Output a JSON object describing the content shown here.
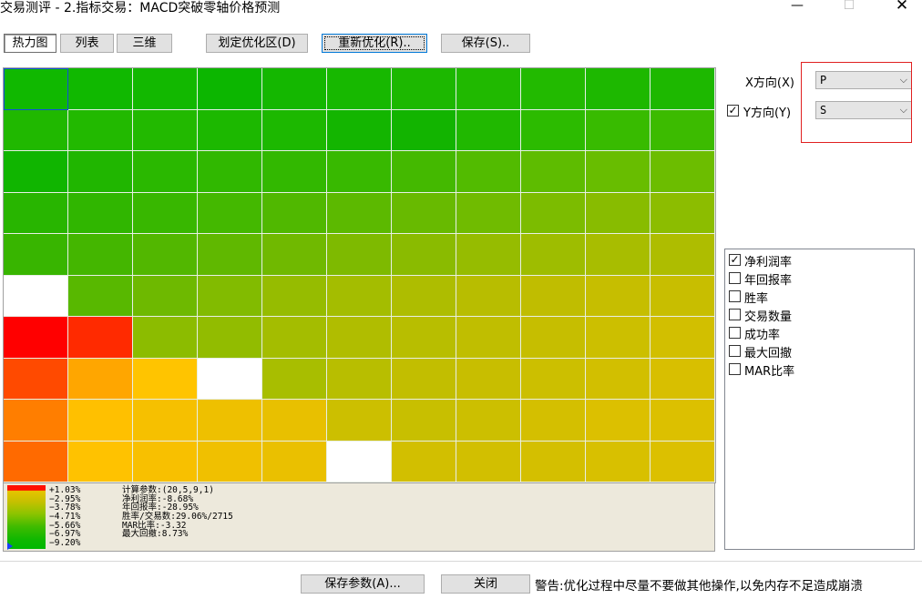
{
  "window": {
    "title": "交易测评 - 2.指标交易：MACD突破零轴价格预测",
    "min_glyph": "—",
    "max_glyph": "☐",
    "close_glyph": "✕"
  },
  "tabs": [
    {
      "label": "热力图",
      "active": true
    },
    {
      "label": "列表",
      "active": false
    },
    {
      "label": "三维",
      "active": false
    }
  ],
  "toolbar": {
    "define_region": "划定优化区(D)",
    "reoptimize": "重新优化(R)..",
    "save": "保存(S).."
  },
  "axes": {
    "x_label": "X方向(X)",
    "x_value": "P",
    "y_label": "Y方向(Y)",
    "y_value": "S",
    "y_checked": true,
    "chevron": "⌵",
    "check_glyph": "✓"
  },
  "metrics": [
    {
      "label": "净利润率",
      "checked": true
    },
    {
      "label": "年回报率",
      "checked": false
    },
    {
      "label": "胜率",
      "checked": false
    },
    {
      "label": "交易数量",
      "checked": false
    },
    {
      "label": "成功率",
      "checked": false
    },
    {
      "label": "最大回撤",
      "checked": false
    },
    {
      "label": "MAR比率",
      "checked": false
    }
  ],
  "heatmap": {
    "rows": 10,
    "cols": 11,
    "selected_cell": [
      0,
      0
    ],
    "colors": [
      [
        "#10b800",
        "#10b800",
        "#12b800",
        "#0cb600",
        "#14b700",
        "#17b800",
        "#1cb800",
        "#20b900",
        "#22ba00",
        "#1db800",
        "#1db800"
      ],
      [
        "#20b800",
        "#22b900",
        "#22b900",
        "#1cb800",
        "#1cb800",
        "#13b500",
        "#12b400",
        "#20b800",
        "#2cbb00",
        "#38bb00",
        "#3cbb00"
      ],
      [
        "#10b500",
        "#20b600",
        "#2ab800",
        "#30b800",
        "#32b800",
        "#38b900",
        "#44b900",
        "#52bb00",
        "#5ebc00",
        "#68bd00",
        "#6cbd00"
      ],
      [
        "#28b500",
        "#30b600",
        "#38b700",
        "#44b800",
        "#50b800",
        "#5cb900",
        "#68ba00",
        "#70bb00",
        "#7cbc00",
        "#88bc00",
        "#8cbd00"
      ],
      [
        "#38b500",
        "#44b600",
        "#52b700",
        "#60b800",
        "#70b900",
        "#7eba00",
        "#8abb00",
        "#96bc00",
        "#9ebd00",
        "#a8bd00",
        "#aebd00"
      ],
      [
        "#ffffff",
        "#58b800",
        "#6eb900",
        "#82bb00",
        "#96bc00",
        "#a4bd00",
        "#aebd00",
        "#b8bd00",
        "#c0bd00",
        "#c6be00",
        "#c8be00"
      ],
      [
        "#ff0000",
        "#ff2a00",
        "#8cbc00",
        "#92bc00",
        "#a4bd00",
        "#b0bd00",
        "#b8be00",
        "#c0be00",
        "#c6be00",
        "#ccbf00",
        "#d2bf00"
      ],
      [
        "#ff4a00",
        "#ffa600",
        "#ffc400",
        "#ffffff",
        "#a8be00",
        "#b8be00",
        "#c2be00",
        "#c8be00",
        "#ccbf00",
        "#d2bf00",
        "#d8bf00"
      ],
      [
        "#ff7e00",
        "#ffc000",
        "#f6c000",
        "#eec000",
        "#e8c000",
        "#ccbf00",
        "#c8bf00",
        "#ccbf00",
        "#d4bf00",
        "#dcc000",
        "#dcc000"
      ],
      [
        "#ff6a00",
        "#ffc200",
        "#f8c000",
        "#f0c000",
        "#eac000",
        "#ffffff",
        "#d2bf00",
        "#d2bf00",
        "#d4bf00",
        "#d8c000",
        "#dcc000"
      ]
    ]
  },
  "legend": {
    "labels": [
      "+1.03%",
      "−2.95%",
      "−3.78%",
      "−4.71%",
      "−5.66%",
      "−6.97%",
      "−9.20%"
    ]
  },
  "stats": {
    "lines": [
      "计算参数:(20,5,9,1)",
      "净利润率:-8.68%",
      "年回报率:-28.95%",
      "胜率/交易数:29.06%/2715",
      "MAR比率:-3.32",
      "最大回撤:8.73%"
    ]
  },
  "footer": {
    "save_params": "保存参数(A)...",
    "close": "关闭",
    "warning": "警告:优化过程中尽量不要做其他操作,以免内存不足造成崩溃"
  }
}
